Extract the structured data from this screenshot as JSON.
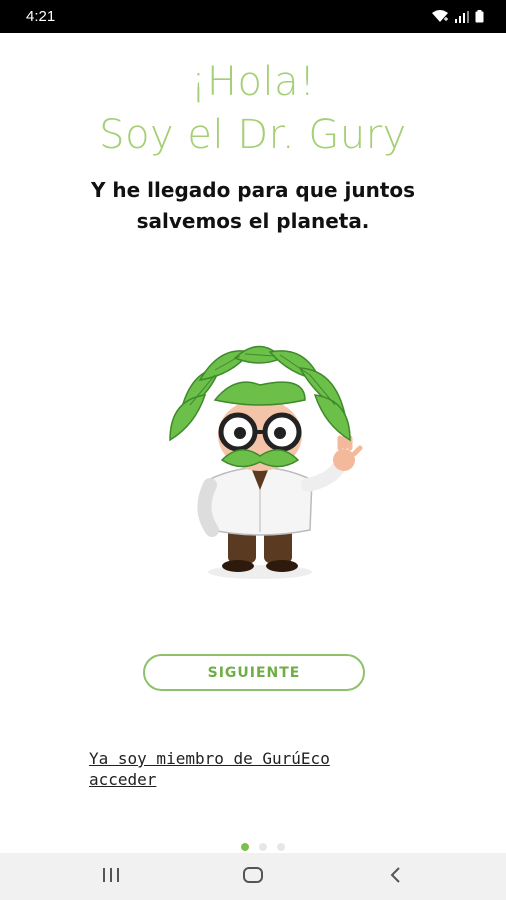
{
  "status_bar": {
    "time": "4:21",
    "icons": [
      "wifi-icon",
      "signal-icon",
      "battery-icon"
    ]
  },
  "onboarding": {
    "greeting_line1": "¡Hola!",
    "greeting_line2": "Soy el Dr. Gury",
    "subtitle_line1": "Y he llegado para que juntos",
    "subtitle_line2": "salvemos el planeta.",
    "next_button": "SIGUIENTE",
    "member_link_line1": "Ya soy miembro de GurúEco",
    "member_link_line2": "acceder",
    "pager": {
      "pages": 3,
      "current": 1
    }
  },
  "nav_bar": {
    "buttons": [
      "recent-apps-icon",
      "home-icon",
      "back-icon"
    ]
  },
  "colors": {
    "accent_green": "#a4cf74",
    "button_green": "#8dc26a",
    "active_dot": "#7cc04b"
  }
}
